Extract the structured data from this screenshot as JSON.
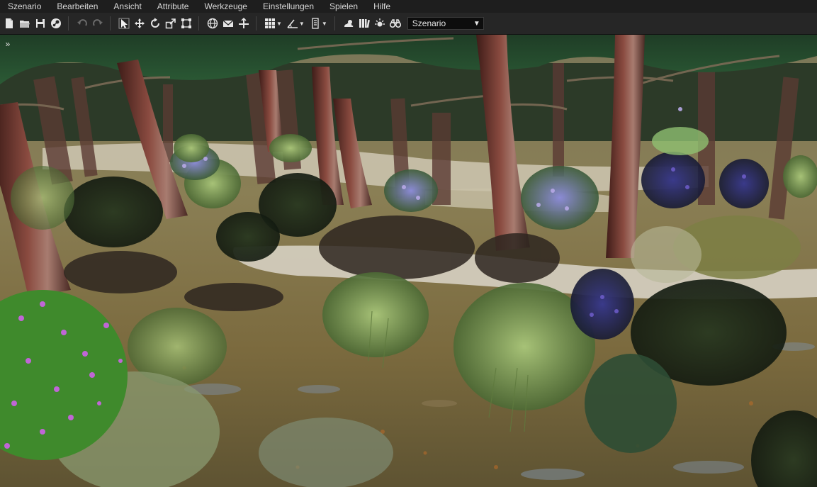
{
  "menubar": {
    "items": [
      "Szenario",
      "Bearbeiten",
      "Ansicht",
      "Attribute",
      "Werkzeuge",
      "Einstellungen",
      "Spielen",
      "Hilfe"
    ]
  },
  "toolbar": {
    "icons": {
      "new": "new-file-icon",
      "open": "open-folder-icon",
      "save": "save-icon",
      "publish": "steam-icon",
      "undo": "undo-icon",
      "redo": "redo-icon",
      "select": "cursor-select-icon",
      "move": "move-icon",
      "rotate": "rotate-icon",
      "scale": "scale-icon",
      "bounds": "bounding-box-icon",
      "globe": "globe-icon",
      "envelope": "envelope-icon",
      "snap": "snap-axis-icon",
      "grid": "grid-icon",
      "angle": "angle-snap-icon",
      "layers": "layer-icon",
      "weather": "weather-icon",
      "library": "library-icon",
      "lighting": "sun-icon",
      "camera": "binoculars-icon"
    },
    "scenario_select": {
      "value": "Szenario"
    }
  },
  "viewport": {
    "expand_label": "»",
    "scene": "3d-forest-scene"
  },
  "colors": {
    "menubar_bg": "#1e1e1e",
    "toolbar_bg": "#262626",
    "text": "#d8d8d8"
  }
}
